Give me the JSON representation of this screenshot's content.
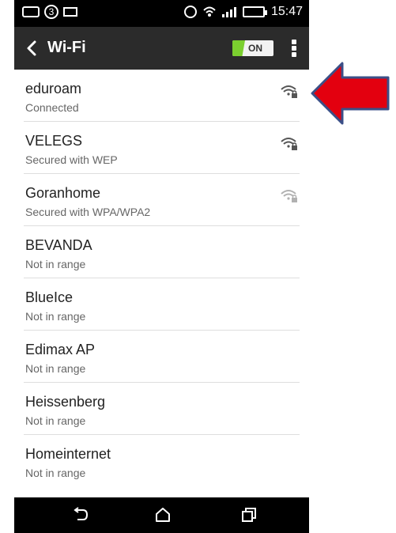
{
  "statusbar": {
    "notification_count": "3",
    "time": "15:47"
  },
  "header": {
    "title": "Wi-Fi",
    "toggle_state": "ON"
  },
  "networks": [
    {
      "name": "eduroam",
      "status": "Connected",
      "secured": true,
      "signal": "strong"
    },
    {
      "name": "VELEGS",
      "status": "Secured with WEP",
      "secured": true,
      "signal": "strong"
    },
    {
      "name": "Goranhome",
      "status": "Secured with WPA/WPA2",
      "secured": true,
      "signal": "weak"
    },
    {
      "name": "BEVANDA",
      "status": "Not in range",
      "secured": false,
      "signal": "none"
    },
    {
      "name": "BlueIce",
      "status": "Not in range",
      "secured": false,
      "signal": "none"
    },
    {
      "name": "Edimax AP",
      "status": "Not in range",
      "secured": false,
      "signal": "none"
    },
    {
      "name": "Heissenberg",
      "status": "Not in range",
      "secured": false,
      "signal": "none"
    },
    {
      "name": "Homeinternet",
      "status": "Not in range",
      "secured": false,
      "signal": "none"
    }
  ],
  "colors": {
    "accent_green": "#7bcf2f",
    "header_bg": "#2b2b2b",
    "arrow_red": "#e3000f",
    "arrow_outline": "#3b4f87"
  },
  "icons": {
    "back": "chevron-left-icon",
    "overflow": "more-vertical-icon",
    "wifi_locked": "wifi-lock-icon",
    "nav_back": "back-icon",
    "nav_home": "home-icon",
    "nav_recents": "recents-icon",
    "annotation": "pointer-arrow-icon"
  }
}
